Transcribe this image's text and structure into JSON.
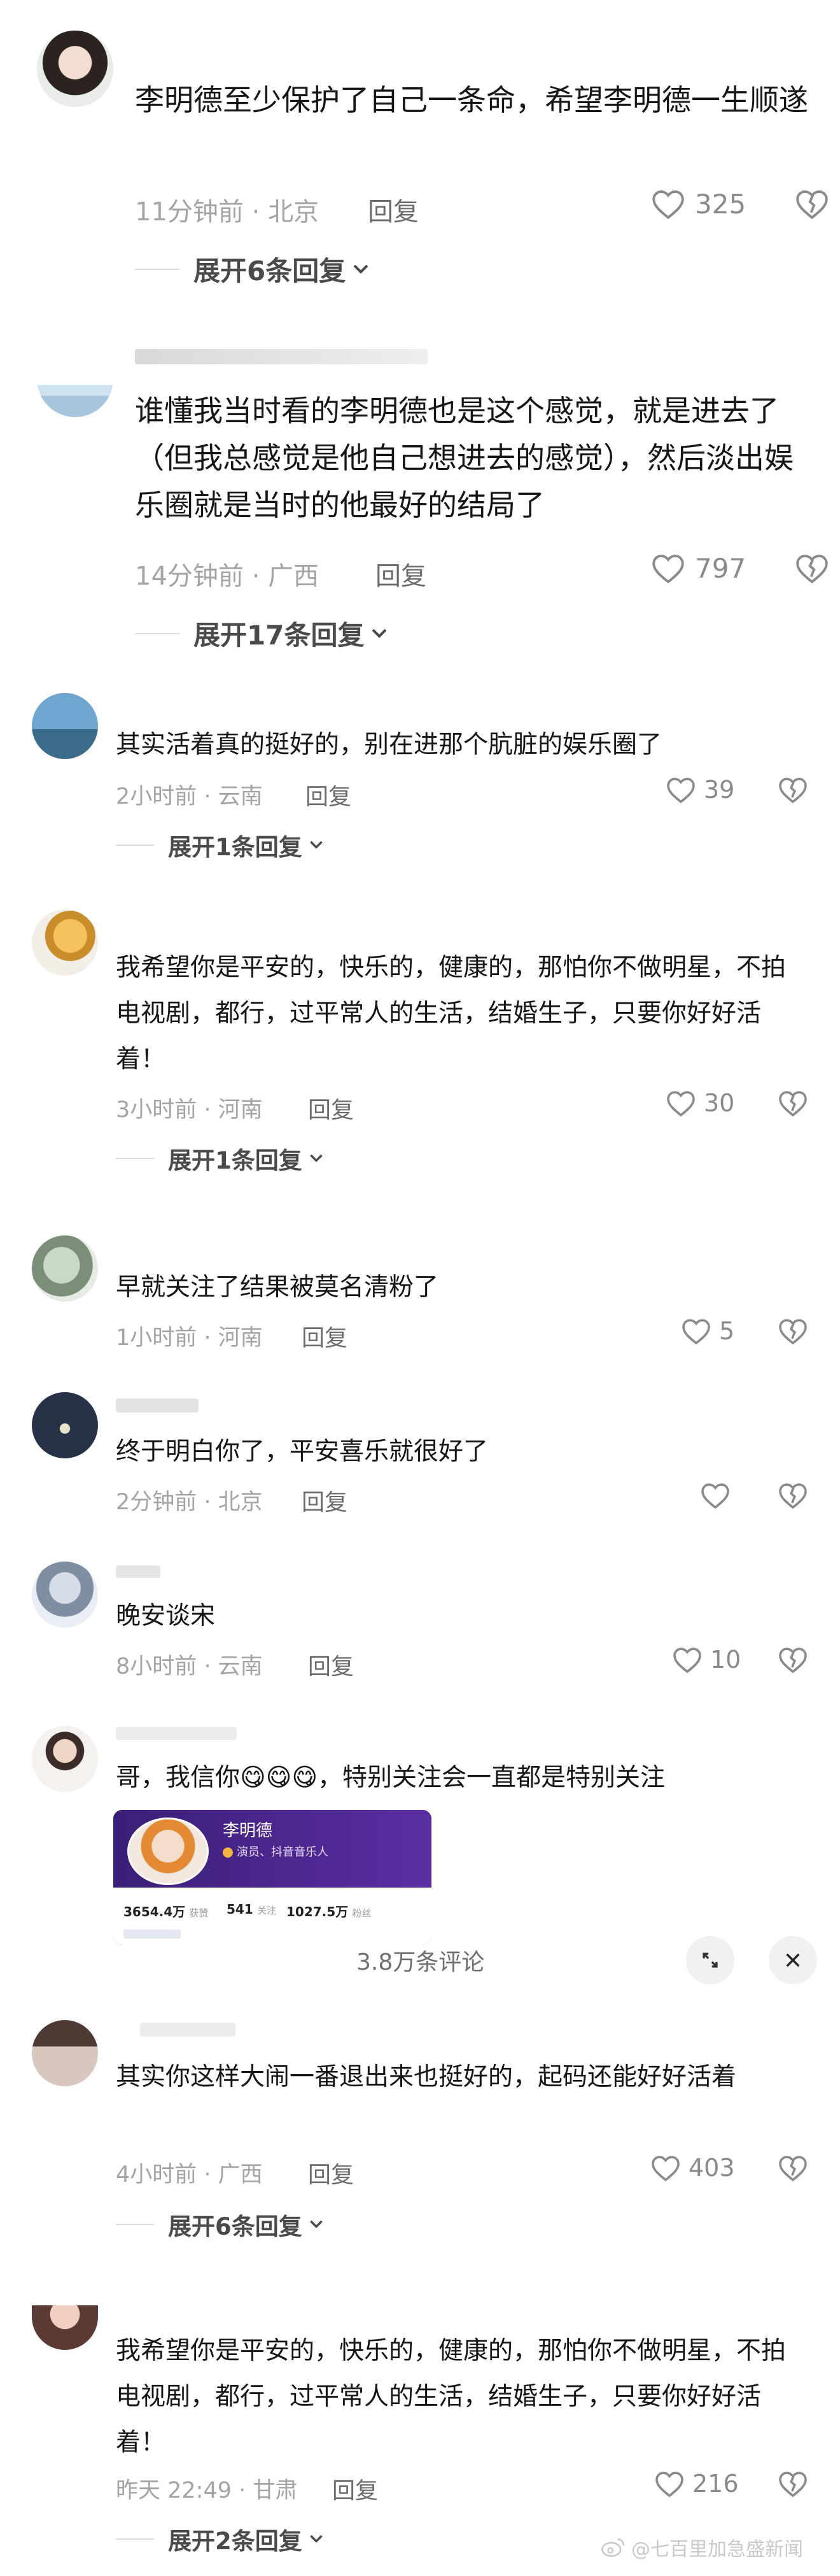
{
  "overlay": {
    "count_label": "3.8万条评论",
    "expand_icon": "expand-icon",
    "close_icon": "close-icon"
  },
  "comments": [
    {
      "text": "李明德至少保护了自己一条命，希望李明德一生顺遂",
      "time": "11分钟前",
      "location": "北京",
      "reply": "回复",
      "likes": "325",
      "expand": "展开6条回复"
    },
    {
      "text": "谁懂我当时看的李明德也是这个感觉，就是进去了（但我总感觉是他自己想进去的感觉），然后淡出娱乐圈就是当时的他最好的结局了",
      "time": "14分钟前",
      "location": "广西",
      "reply": "回复",
      "likes": "797",
      "expand": "展开17条回复"
    },
    {
      "text": "其实活着真的挺好的，别在进那个肮脏的娱乐圈了",
      "time": "2小时前",
      "location": "云南",
      "reply": "回复",
      "likes": "39",
      "expand": "展开1条回复"
    },
    {
      "text": "我希望你是平安的，快乐的，健康的，那怕你不做明星，不拍电视剧，都行，过平常人的生活，结婚生子，只要你好好活着！",
      "time": "3小时前",
      "location": "河南",
      "reply": "回复",
      "likes": "30",
      "expand": "展开1条回复"
    },
    {
      "text": "早就关注了结果被莫名清粉了",
      "time": "1小时前",
      "location": "河南",
      "reply": "回复",
      "likes": "5"
    },
    {
      "text": "终于明白你了，平安喜乐就很好了",
      "time": "2分钟前",
      "location": "北京",
      "reply": "回复",
      "likes": ""
    },
    {
      "text": "晚安谈宋",
      "time": "8小时前",
      "location": "云南",
      "reply": "回复",
      "likes": "10"
    },
    {
      "text": "哥，我信你😋😋😋，特别关注会一直都是特别关注"
    },
    {
      "text": "其实你这样大闹一番退出来也挺好的，起码还能好好活着",
      "time": "4小时前",
      "location": "广西",
      "reply": "回复",
      "likes": "403",
      "expand": "展开6条回复"
    },
    {
      "text": "我希望你是平安的，快乐的，健康的，那怕你不做明星，不拍电视剧，都行，过平常人的生活，结婚生子，只要你好好活着！",
      "time": "昨天 22:49",
      "location": "甘肃",
      "reply": "回复",
      "likes": "216",
      "expand": "展开2条回复"
    }
  ],
  "profile_card": {
    "name": "李明德",
    "role": "演员、抖音音乐人",
    "stats": [
      {
        "value": "3654.4万",
        "label": "获赞"
      },
      {
        "value": "541",
        "label": "关注"
      },
      {
        "value": "1027.5万",
        "label": "粉丝"
      }
    ]
  },
  "watermark": "@七百里加急盛新闻"
}
